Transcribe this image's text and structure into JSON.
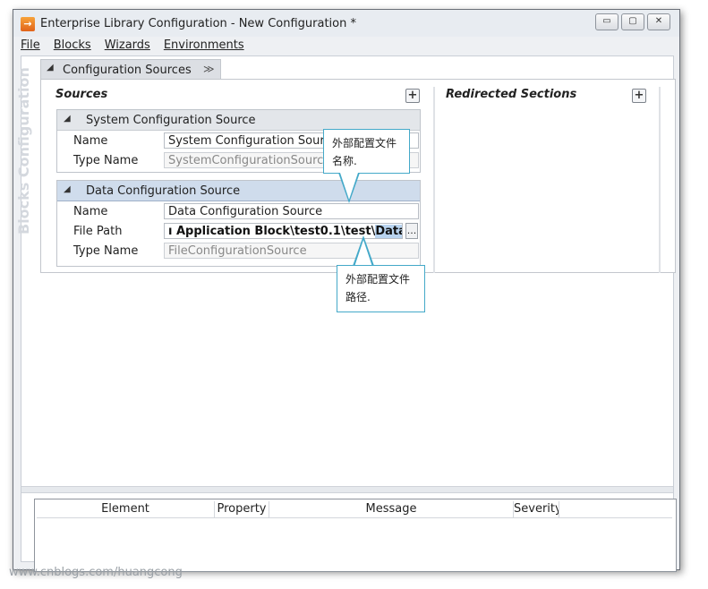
{
  "window": {
    "title": "Enterprise Library Configuration - New Configuration *",
    "icon": "arrow-app-icon",
    "controls": {
      "minimize": "▭",
      "restore": "▢",
      "close": "✕"
    }
  },
  "menu": [
    "File",
    "Blocks",
    "Wizards",
    "Environments"
  ],
  "vertical_title": "Blocks Configuration",
  "section": {
    "title": "Configuration Sources",
    "collapse_glyph": "≫"
  },
  "sources": {
    "heading": "Sources",
    "add_glyph": "+",
    "items": [
      {
        "name": "System Configuration Source",
        "fields": [
          {
            "label": "Name",
            "value": "System Configuration Source"
          },
          {
            "label": "Type Name",
            "value": "SystemConfigurationSource"
          }
        ]
      },
      {
        "name": "Data Configuration Source",
        "fields": [
          {
            "label": "Name",
            "value": "Data Configuration Source"
          },
          {
            "label": "File Path",
            "value_prefix": "ı Application Block\\test0.1\\test\\",
            "value_selected": "Data.config",
            "button": "..."
          },
          {
            "label": "Type Name",
            "value": "FileConfigurationSource"
          }
        ]
      }
    ]
  },
  "redirected": {
    "heading": "Redirected Sections",
    "add_glyph": "+"
  },
  "callouts": [
    {
      "lines": [
        "外部配置文件",
        "名称."
      ]
    },
    {
      "lines": [
        "外部配置文件",
        "路径."
      ]
    }
  ],
  "errors": {
    "columns": [
      "Element",
      "Property",
      "Message",
      "Severity"
    ]
  },
  "watermark": "www.cnblogs.com/huangcong",
  "colors": {
    "accent": "#44a9c9",
    "selection": "#b9d4f0",
    "app_icon": "#e1631a"
  }
}
